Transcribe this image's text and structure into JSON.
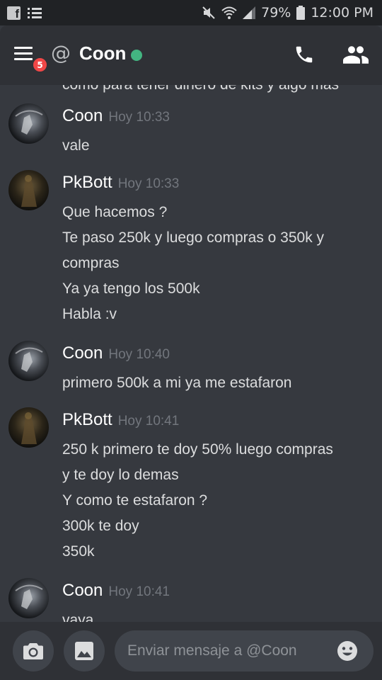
{
  "status_bar": {
    "battery": "79%",
    "time": "12:00 PM"
  },
  "header": {
    "unread_count": "5",
    "at_symbol": "@",
    "channel_name": "Coon",
    "online_color": "#43b581"
  },
  "messages": {
    "cut_off_text": "como para tener dinero de kits y algo mas",
    "groups": [
      {
        "author": "Coon",
        "time": "Hoy 10:33",
        "lines": [
          "vale"
        ]
      },
      {
        "author": "PkBott",
        "time": "Hoy 10:33",
        "lines": [
          "Que hacemos ?",
          "Te paso 250k y luego compras o 350k y",
          "compras",
          "Ya ya tengo los 500k",
          "Habla :v"
        ]
      },
      {
        "author": "Coon",
        "time": "Hoy 10:40",
        "lines": [
          "primero 500k a mi ya me estafaron"
        ]
      },
      {
        "author": "PkBott",
        "time": "Hoy 10:41",
        "lines": [
          "250 k primero te doy 50% luego compras",
          "y te doy lo demas",
          "Y como te estafaron ?",
          "300k te doy",
          "350k"
        ]
      },
      {
        "author": "Coon",
        "time": "Hoy 10:41",
        "lines": [
          "vaya"
        ]
      }
    ]
  },
  "input": {
    "placeholder": "Enviar mensaje a @Coon"
  }
}
